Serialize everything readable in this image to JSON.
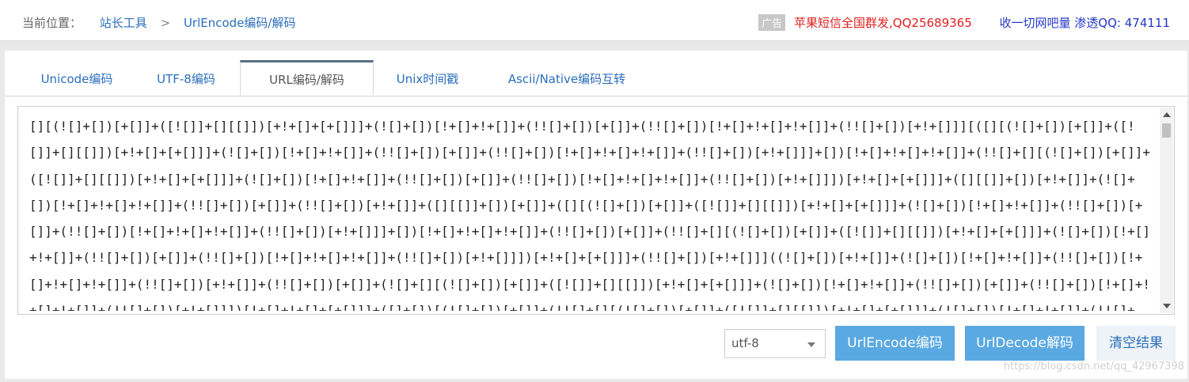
{
  "breadcrumb": {
    "prefix": "当前位置：",
    "home": "站长工具",
    "separator": ">",
    "current": "UrlEncode编码/解码"
  },
  "ads": {
    "tag": "广告",
    "red_link": "苹果短信全国群发,QQ25689365",
    "blue_link": "收一切网吧量 渗透QQ: 474111"
  },
  "tabs": [
    {
      "label": "Unicode编码"
    },
    {
      "label": "UTF-8编码"
    },
    {
      "label": "URL编码/解码"
    },
    {
      "label": "Unix时间戳"
    },
    {
      "label": "Ascii/Native编码互转"
    }
  ],
  "active_tab_index": 2,
  "textarea": {
    "value": "[][(![]+[])[+[]]+([![]]+[][[]])[+!+[]+[+[]]]+(![]+[])[!+[]+!+[]]+(!![]+[])[+[]]+(!![]+[])[!+[]+!+[]+!+[]]+(!![]+[])[+!+[]]][([][(![]+[])[+[]]+([![]]+[][[]])[+!+[]+[+[]]]+(![]+[])[!+[]+!+[]]+(!![]+[])[+[]]+(!![]+[])[!+[]+!+[]+!+[]]+(!![]+[])[+!+[]]]+[])[!+[]+!+[]+!+[]]+(!![]+[][(![]+[])[+[]]+([![]]+[][[]])[+!+[]+[+[]]]+(![]+[])[!+[]+!+[]]+(!![]+[])[+[]]+(!![]+[])[!+[]+!+[]+!+[]]+(!![]+[])[+!+[]]])[+!+[]+[+[]]]+([][[]]+[])[+!+[]]+(![]+[])[!+[]+!+[]+!+[]]+(!![]+[])[+[]]+(!![]+[])[+!+[]]+([][[]]+[])[+[]]+([][(![]+[])[+[]]+([![]]+[][[]])[+!+[]+[+[]]]+(![]+[])[!+[]+!+[]]+(!![]+[])[+[]]+(!![]+[])[!+[]+!+[]+!+[]]+(!![]+[])[+!+[]]]+[])[!+[]+!+[]+!+[]]+(!![]+[])[+[]]+(!![]+[][(![]+[])[+[]]+([![]]+[][[]])[+!+[]+[+[]]]+(![]+[])[!+[]+!+[]]+(!![]+[])[+[]]+(!![]+[])[!+[]+!+[]+!+[]]+(!![]+[])[+!+[]]])[+!+[]+[+[]]]+(!![]+[])[+!+[]]]((![]+[])[+!+[]]+(![]+[])[!+[]+!+[]]+(!![]+[])[!+[]+!+[]+!+[]]+(!![]+[])[+!+[]]+(!![]+[])[+[]]+(![]+[][(![]+[])[+[]]+([![]]+[][[]])[+!+[]+[+[]]]+(![]+[])[!+[]+!+[]]+(!![]+[])[+[]]+(!![]+[])[!+[]+!+[]+!+[]]+(!![]+[])[+!+[]]])[!+[]+!+[]+[+[]]]+([]+[])[(![]+[])[+[]]+(!![]+[][(![]+[])[+[]]+([![]]+[][[]])[+!+[]+[+[]]]+(![]+[])[!+[]+!+[]]+(!![]+[])[+[]]+(!![]+[])[!+[]+!+[]+!+[]]+(!![]+[])[+!+[]]])[+!+[]+[+[]]]+([][[]]+[])[+!+[]]+(!![]+[])[+[]]+([][(![]+[])[+[]]+([![]]+[][[]])[+!+[]+[+[]]]+(![]+[])[!+[]+!+[]]+(!![]+[])[+[]]+(!![]+[])[!+[]+!+[]+!+[]]+(!![]+[])[+!+[]]]+[])[!+[]+!+[]+!+[]]+(!![]+[][(![]+[])[+[]]+([![]]+[][[]])[+!+[]+[+[]]]+(![]+[])[!+[]+!+[]]+(!![]+[])[+[]]+(!![]+[])[!+[]+!+[]+!+[]]+(!![]+[])[+!+[]]])[+!+[]+[+[]]]+(![]+[])[!+[]+!+[]]+(!![]+[][(![]+[])[+[]]+([![]]+[][[]])[+!+[]+[+[]]]+(![]+[])[!+[]+!+[]]+(!![]+[])[+[]]+(!![]+[])[!+[]+!+[]+!+[]]+(!![]+[])[+!+[]]])[+!+[]+[+[]]]+(!![]+[])[+!+[]]]()[+!+[]+[!+[]+!+[]]]"
  },
  "charset_select": {
    "value": "utf-8"
  },
  "buttons": {
    "encode": "UrlEncode编码",
    "decode": "UrlDecode解码",
    "clear": "清空结果"
  },
  "watermark": "https://blog.csdn.net/qq_42967398"
}
